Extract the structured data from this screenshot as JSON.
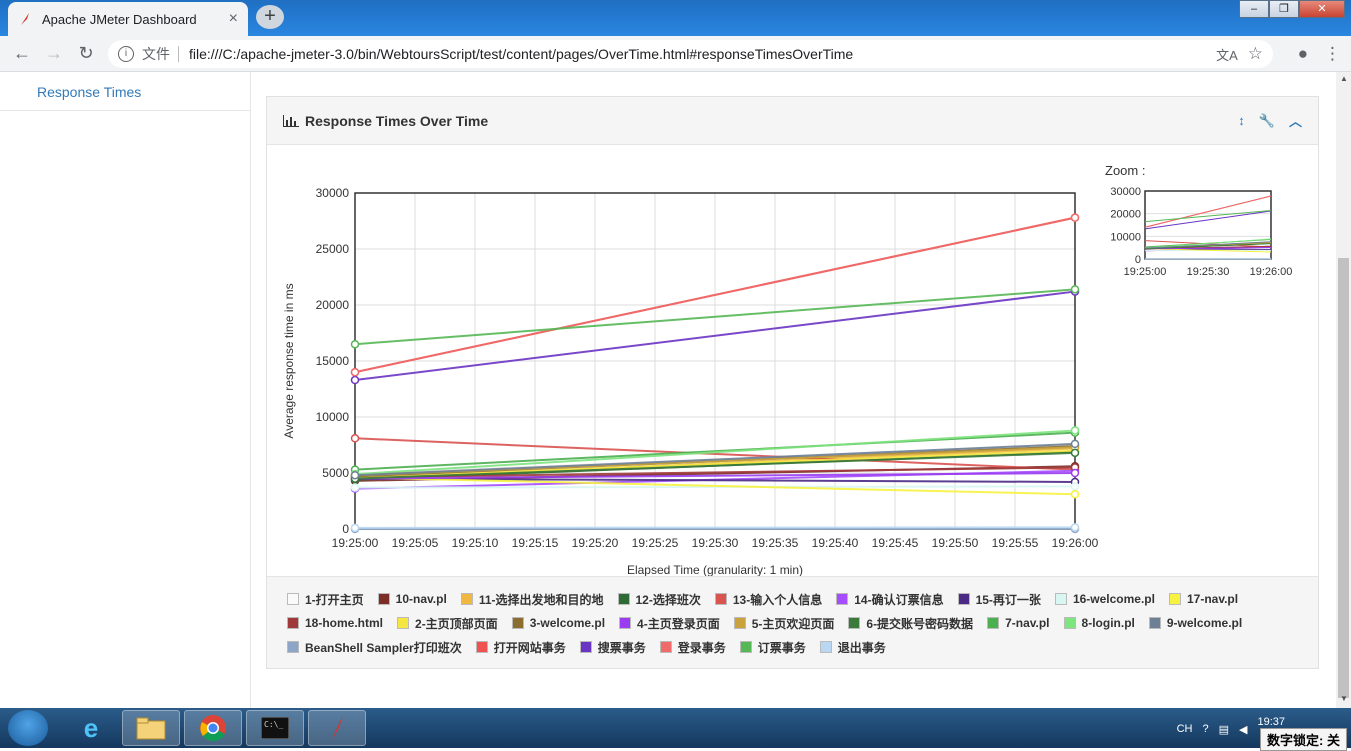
{
  "browser": {
    "tab_title": "Apache JMeter Dashboard",
    "secure_label": "文件",
    "url": "file:///C:/apache-jmeter-3.0/bin/WebtoursScript/test/content/pages/OverTime.html#responseTimesOverTime"
  },
  "sidebar": {
    "items": [
      {
        "label": "Response Times"
      }
    ]
  },
  "panel": {
    "title": "Response Times Over Time"
  },
  "zoom": {
    "label": "Zoom :"
  },
  "chart_data": {
    "type": "line",
    "xlabel": "Elapsed Time (granularity: 1 min)",
    "ylabel": "Average response time in ms",
    "x": [
      "19:25:00",
      "19:26:00"
    ],
    "xticks": [
      "19:25:00",
      "19:25:05",
      "19:25:10",
      "19:25:15",
      "19:25:20",
      "19:25:25",
      "19:25:30",
      "19:25:35",
      "19:25:40",
      "19:25:45",
      "19:25:50",
      "19:25:55",
      "19:26:00"
    ],
    "ylim": [
      0,
      30000
    ],
    "yticks": [
      0,
      5000,
      10000,
      15000,
      20000,
      25000,
      30000
    ],
    "grid": true,
    "legend_position": "bottom",
    "series": [
      {
        "name": "1-打开主页",
        "color": "#fafafa",
        "values": [
          4900,
          7500
        ]
      },
      {
        "name": "10-nav.pl",
        "color": "#7b2d26",
        "values": [
          4300,
          5600
        ]
      },
      {
        "name": "11-选择出发地和目的地",
        "color": "#f0b840",
        "values": [
          4500,
          7200
        ]
      },
      {
        "name": "12-选择班次",
        "color": "#2e6b34",
        "values": [
          4400,
          6900
        ]
      },
      {
        "name": "13-输入个人信息",
        "color": "#d9534f",
        "values": [
          8100,
          5300
        ]
      },
      {
        "name": "14-确认订票信息",
        "color": "#a64dff",
        "values": [
          3600,
          5200
        ]
      },
      {
        "name": "15-再订一张",
        "color": "#4b2a86",
        "values": [
          4500,
          4200
        ]
      },
      {
        "name": "16-welcome.pl",
        "color": "#d9f7f2",
        "values": [
          3700,
          3800
        ]
      },
      {
        "name": "17-nav.pl",
        "color": "#f7f240",
        "values": [
          4600,
          3100
        ]
      },
      {
        "name": "18-home.html",
        "color": "#a03a3a",
        "values": [
          4600,
          5500
        ]
      },
      {
        "name": "2-主页顶部页面",
        "color": "#f5e642",
        "values": [
          4600,
          7000
        ]
      },
      {
        "name": "3-welcome.pl",
        "color": "#8a6d2f",
        "values": [
          4700,
          7400
        ]
      },
      {
        "name": "4-主页登录页面",
        "color": "#9b3cf0",
        "values": [
          4500,
          5000
        ]
      },
      {
        "name": "5-主页欢迎页面",
        "color": "#c9a23c",
        "values": [
          4800,
          7300
        ]
      },
      {
        "name": "6-提交账号密码数据",
        "color": "#3a7a3a",
        "values": [
          4500,
          6800
        ]
      },
      {
        "name": "7-nav.pl",
        "color": "#4caf50",
        "values": [
          5300,
          8600
        ]
      },
      {
        "name": "8-login.pl",
        "color": "#7ee47e",
        "values": [
          4900,
          8800
        ]
      },
      {
        "name": "9-welcome.pl",
        "color": "#6e8096",
        "values": [
          4800,
          7600
        ]
      },
      {
        "name": "BeanShell Sampler打印班次",
        "color": "#8da6c8",
        "values": [
          0,
          0
        ]
      },
      {
        "name": "打开网站事务",
        "color": "#ef5350",
        "values": [
          14000,
          27800
        ]
      },
      {
        "name": "搜票事务",
        "color": "#6a35c4",
        "values": [
          13300,
          21200
        ]
      },
      {
        "name": "登录事务",
        "color": "#f06a6a",
        "values": [
          14000,
          27800
        ]
      },
      {
        "name": "订票事务",
        "color": "#55b855",
        "values": [
          16500,
          21400
        ]
      },
      {
        "name": "退出事务",
        "color": "#b9d6f2",
        "values": [
          100,
          150
        ]
      }
    ]
  },
  "zoom_chart": {
    "yticks": [
      0,
      10000,
      20000,
      30000
    ],
    "xticks": [
      "19:25:00",
      "19:25:30",
      "19:26:00"
    ]
  },
  "taskbar": {
    "tray_lang": "CH",
    "tray_time": "19:37",
    "numlock": "数字锁定: 关"
  }
}
